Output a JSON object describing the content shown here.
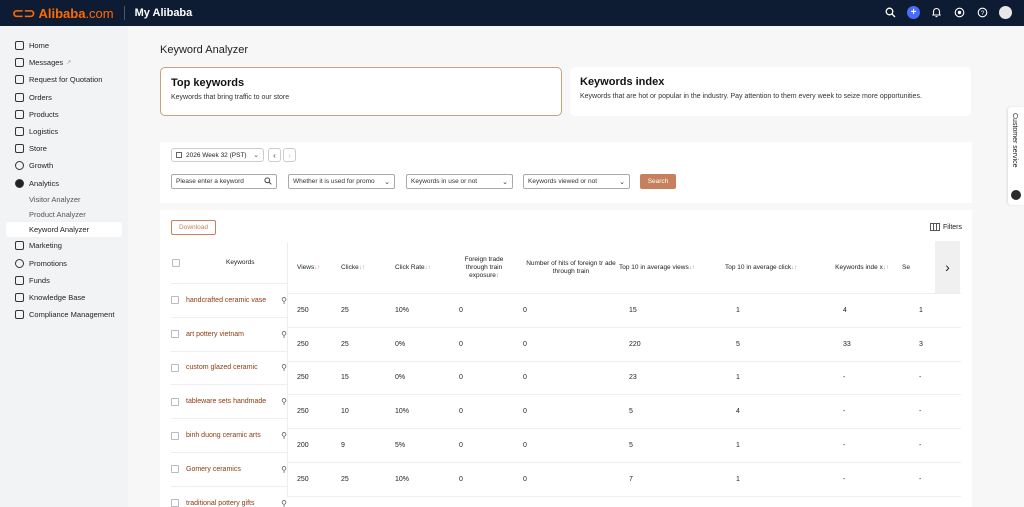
{
  "topbar": {
    "brand": "Alibaba",
    "brand_suffix": ".com",
    "title": "My Alibaba",
    "icons": [
      "search-icon",
      "plus-icon",
      "bell-icon",
      "support-icon",
      "help-icon",
      "avatar"
    ]
  },
  "sidebar": {
    "items": [
      {
        "label": "Home"
      },
      {
        "label": "Messages"
      },
      {
        "label": "Request for Quotation"
      },
      {
        "label": "Orders"
      },
      {
        "label": "Products"
      },
      {
        "label": "Logistics"
      },
      {
        "label": "Store"
      },
      {
        "label": "Growth"
      },
      {
        "label": "Analytics"
      },
      {
        "label": "Marketing"
      },
      {
        "label": "Promotions"
      },
      {
        "label": "Funds"
      },
      {
        "label": "Knowledge Base"
      },
      {
        "label": "Compliance Management"
      }
    ],
    "analytics_sub": [
      {
        "label": "Visitor Analyzer"
      },
      {
        "label": "Product Analyzer"
      },
      {
        "label": "Keyword Analyzer"
      }
    ]
  },
  "page": {
    "title": "Keyword Analyzer",
    "tabs": [
      {
        "title": "Top keywords",
        "desc": "Keywords that bring traffic to our store"
      },
      {
        "title": "Keywords index",
        "desc": "Keywords that are hot or popular in the industry. Pay attention to them every week to seize more opportunities."
      }
    ]
  },
  "filters": {
    "week": "2026 Week 32 (PST)",
    "keyword_placeholder": "Please enter a keyword",
    "promo": "Whether it is used for promo",
    "in_use": "Keywords in use or not",
    "viewed": "Keywords viewed or not",
    "search": "Search"
  },
  "table": {
    "download": "Download",
    "filters": "Filters",
    "keywords_header": "Keywords",
    "columns": [
      "Views",
      "Clicks",
      "Click Rate",
      "Foreign trade through train exposure",
      "Number of hits of foreign trade through train",
      "Top 10 in average views",
      "Top 10 in average click",
      "Keywords index",
      "Se"
    ],
    "column_display": [
      "Views",
      "Clicke",
      "Click Rate",
      "Foreign trade through train exposure",
      "Number of hits of foreign tr ade through train",
      "Top 10 in average views",
      "Top 10 in average click",
      "Keywords inde x",
      "Se"
    ],
    "rows": [
      {
        "keyword": "handcrafted ceramic vase",
        "values": [
          "250",
          "25",
          "10%",
          "0",
          "0",
          "15",
          "1",
          "4",
          "1"
        ]
      },
      {
        "keyword": "art pottery vietnam",
        "values": [
          "250",
          "25",
          "0%",
          "0",
          "0",
          "220",
          "5",
          "33",
          "3"
        ]
      },
      {
        "keyword": "custom glazed ceramic",
        "values": [
          "250",
          "15",
          "0%",
          "0",
          "0",
          "23",
          "1",
          "-",
          "-"
        ]
      },
      {
        "keyword": "tableware sets handmade",
        "values": [
          "250",
          "10",
          "10%",
          "0",
          "0",
          "5",
          "4",
          "-",
          "-"
        ]
      },
      {
        "keyword": "binh duong ceramic arts",
        "values": [
          "200",
          "9",
          "5%",
          "0",
          "0",
          "5",
          "1",
          "-",
          "-"
        ]
      },
      {
        "keyword": "Gomery ceramics",
        "values": [
          "250",
          "25",
          "10%",
          "0",
          "0",
          "7",
          "1",
          "-",
          "-"
        ]
      },
      {
        "keyword": "traditional pottery gifts",
        "values": []
      }
    ]
  },
  "customer_service": "Customer service",
  "colors": {
    "accent": "#c6805d",
    "topbar": "#0e1c33",
    "brand": "#ff6a00",
    "keyword": "#8a3a10"
  }
}
